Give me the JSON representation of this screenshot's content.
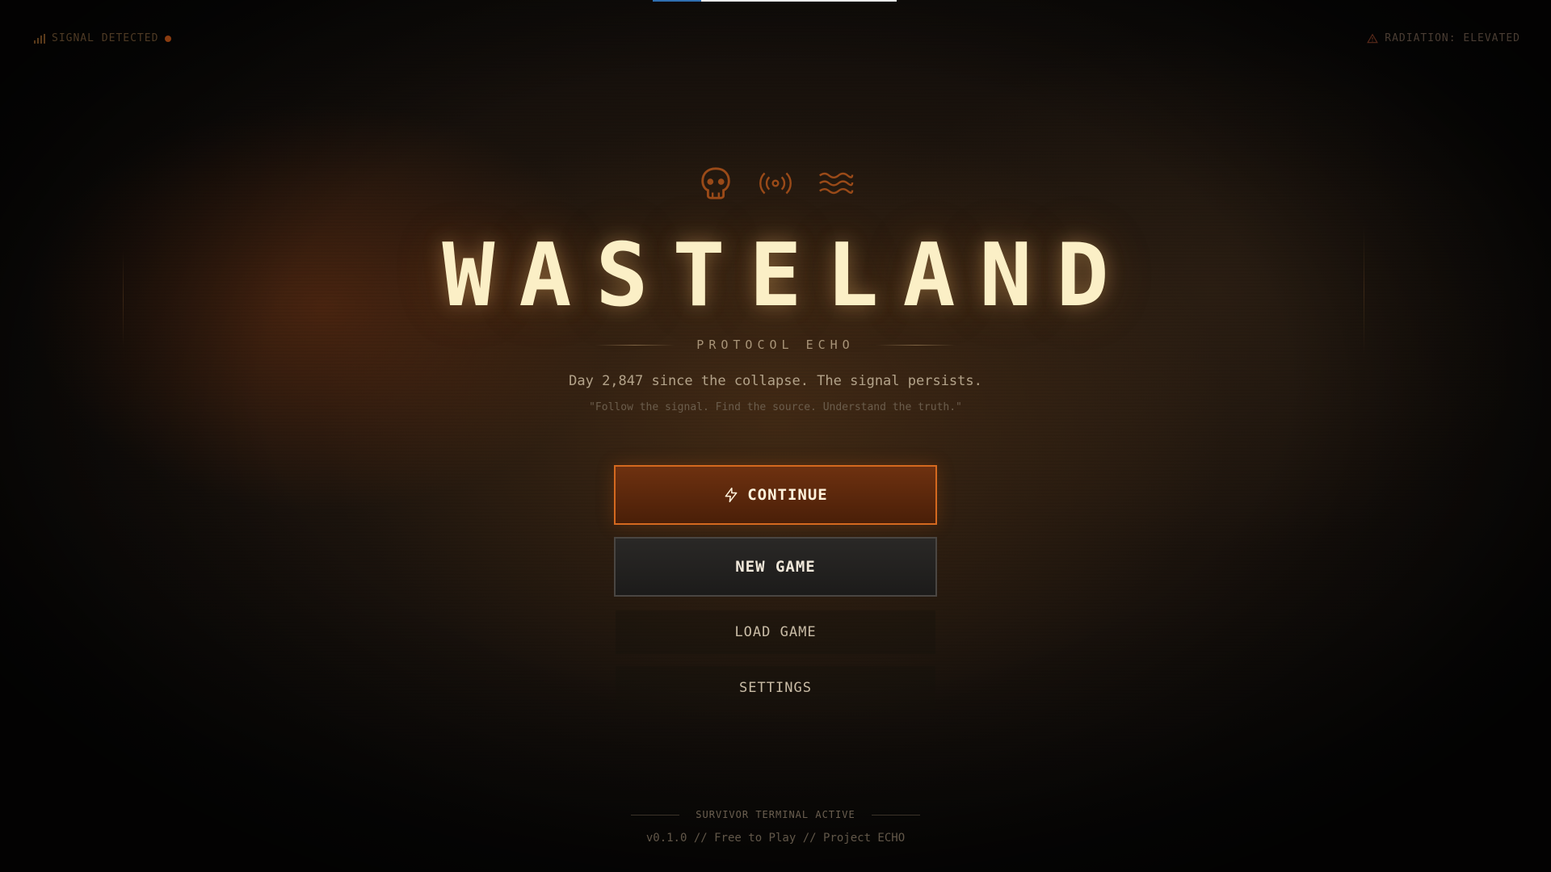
{
  "corners": {
    "signal_label": "SIGNAL DETECTED",
    "radiation_label": "RADIATION: ELEVATED"
  },
  "loading": {
    "progress_fraction": 0.2
  },
  "icons": [
    "skull-icon",
    "broadcast-signal-icon",
    "waves-icon"
  ],
  "title": "WASTELAND",
  "subtitle": "PROTOCOL ECHO",
  "tagline": "Day 2,847 since the collapse. The signal persists.",
  "quote": "\"Follow the signal. Find the source. Understand the truth.\"",
  "menu": {
    "continue_label": "CONTINUE",
    "new_game_label": "NEW GAME",
    "load_game_label": "LOAD GAME",
    "settings_label": "SETTINGS"
  },
  "footer": {
    "status": "SURVIVOR TERMINAL ACTIVE",
    "version": "v0.1.0 // Free to Play // Project ECHO"
  },
  "colors": {
    "accent": "#d4691f",
    "title": "#fbefc6",
    "icon": "#9a4a18"
  }
}
